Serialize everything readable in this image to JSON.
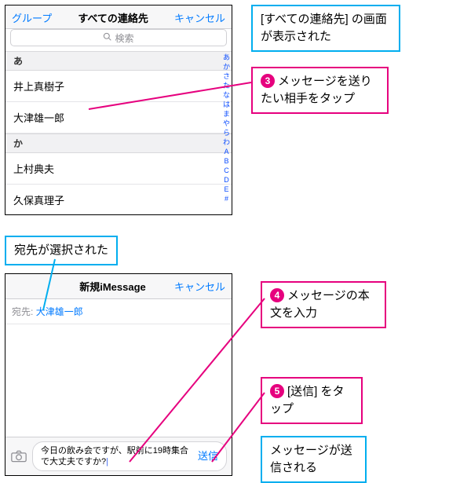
{
  "contacts": {
    "nav": {
      "left": "グループ",
      "title": "すべての連絡先",
      "right": "キャンセル"
    },
    "search_placeholder": "検索",
    "sections": [
      {
        "header": "あ",
        "rows": [
          "井上真樹子",
          "大津雄一郎"
        ]
      },
      {
        "header": "か",
        "rows": [
          "上村典夫",
          "久保真理子"
        ]
      }
    ],
    "index": [
      "あ",
      "か",
      "さ",
      "た",
      "な",
      "は",
      "ま",
      "や",
      "ら",
      "わ",
      "A",
      "B",
      "C",
      "D",
      "E",
      "#"
    ]
  },
  "message": {
    "nav": {
      "title": "新規iMessage",
      "right": "キャンセル"
    },
    "recipient_label": "宛先:",
    "recipient_name": "大津雄一郎",
    "draft_text": "今日の飲み会ですが、駅前に19時集合で大丈夫ですか?",
    "send_label": "送信"
  },
  "callouts": {
    "c1": "[すべての連絡先] の画面が表示された",
    "c2_badge": "3",
    "c2": "メッセージを送りたい相手をタップ",
    "c3": "宛先が選択された",
    "c4_badge": "4",
    "c4": "メッセージの本文を入力",
    "c5_badge": "5",
    "c5": "[送信] をタップ",
    "c6": "メッセージが送信される"
  }
}
